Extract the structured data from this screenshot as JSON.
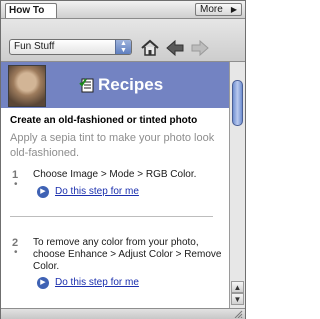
{
  "tabs": {
    "active_label": "How To",
    "more_label": "More"
  },
  "toolbar": {
    "category_selected": "Fun Stuff"
  },
  "banner": {
    "title": "Recipes"
  },
  "recipe": {
    "title": "Create an old-fashioned or tinted photo",
    "intro": "Apply a sepia tint to make your photo look old-fashioned.",
    "steps": [
      {
        "number": "1",
        "text": "Choose Image > Mode > RGB Color.",
        "link": "Do this step for me"
      },
      {
        "number": "2",
        "text": "To remove any color from your photo, choose Enhance > Adjust Color > Remove Color.",
        "link": "Do this step for me"
      }
    ]
  },
  "colors": {
    "banner": "#7383c2",
    "link": "#1b2fae",
    "accent": "#3f62b4"
  },
  "icons": [
    "home-icon",
    "back-arrow-icon",
    "forward-arrow-icon",
    "recipes-checklist-icon",
    "play-icon"
  ]
}
